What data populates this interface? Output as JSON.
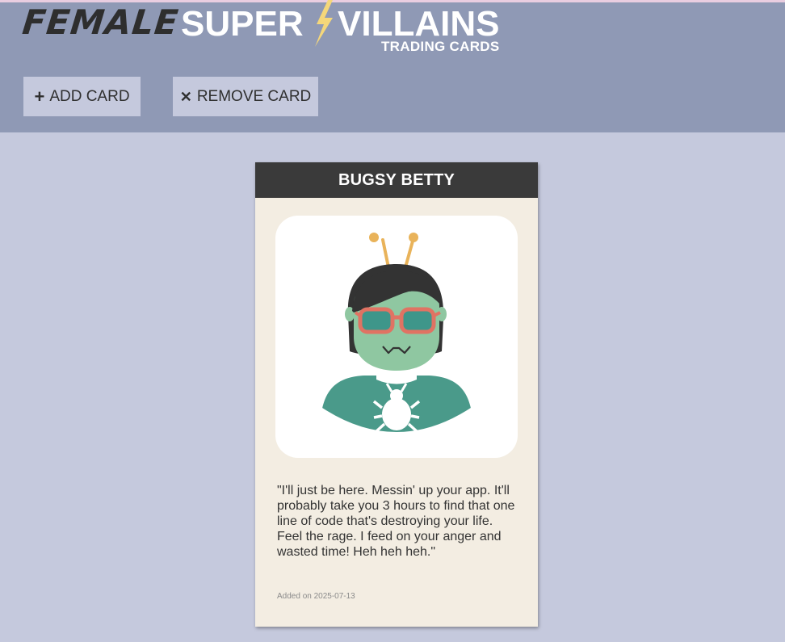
{
  "app": {
    "logo_female": "FEMALE",
    "logo_super": "SUPER",
    "logo_villains": "VILLAINS",
    "logo_subtitle": "TRADING CARDS"
  },
  "toolbar": {
    "add_icon": "+",
    "add_label": "ADD CARD",
    "remove_icon": "✕",
    "remove_label": "REMOVE CARD"
  },
  "card": {
    "name": "BUGSY BETTY",
    "quote": "\"I'll just be here. Messin' up your app. It'll probably take you 3 hours to find that one line of code that's destroying your life. Feel the rage. I feed on your anger and wasted time! Heh heh heh.\"",
    "added": "Added on 2025-07-13",
    "avatar_icon": "bug-villain-avatar"
  },
  "colors": {
    "header_bg": "#8f99b5",
    "page_bg": "#c5c9dd",
    "card_bg": "#f3ede2",
    "card_header_bg": "#3a3a3a",
    "bolt": "#f5d77a"
  }
}
